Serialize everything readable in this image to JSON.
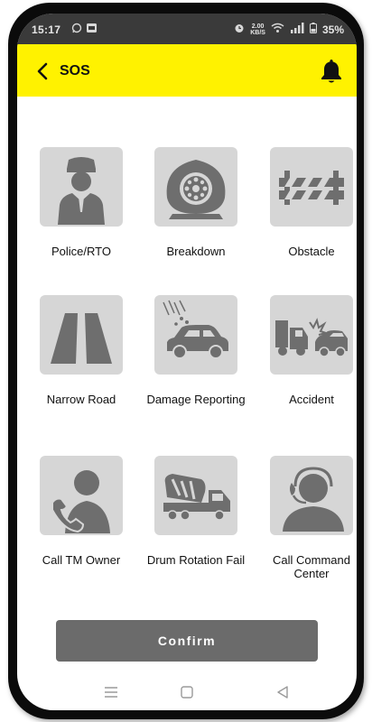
{
  "status_bar": {
    "time": "15:17",
    "net_speed_value": "2.00",
    "net_speed_unit": "KB/S",
    "battery": "35%",
    "icons": [
      "whatsapp-icon",
      "gallery-icon",
      "alarm-icon",
      "wifi-icon",
      "signal-icon",
      "battery-icon"
    ]
  },
  "app_bar": {
    "title": "SOS",
    "back_icon": "back-chevron-icon",
    "bell_icon": "bell-icon",
    "color": "#fff200"
  },
  "tiles": [
    {
      "label": "Police/RTO",
      "icon": "police-icon"
    },
    {
      "label": "Breakdown",
      "icon": "tyre-icon"
    },
    {
      "label": "Obstacle",
      "icon": "barrier-icon"
    },
    {
      "label": "Narrow Road",
      "icon": "road-icon"
    },
    {
      "label": "Damage Reporting",
      "icon": "car-damage-icon"
    },
    {
      "label": "Accident",
      "icon": "accident-icon"
    },
    {
      "label": "Call TM Owner",
      "icon": "call-person-icon"
    },
    {
      "label": "Drum Rotation Fail",
      "icon": "mixer-truck-icon"
    },
    {
      "label": "Call Command Center",
      "icon": "headset-person-icon"
    }
  ],
  "confirm_button": {
    "label": "Confirm"
  },
  "nav_bar": {
    "icons": [
      "menu-icon",
      "home-icon",
      "back-icon"
    ]
  },
  "colors": {
    "tile_bg": "#d6d6d6",
    "icon_gray": "#6e6e6e",
    "button_gray": "#6b6b6b"
  }
}
